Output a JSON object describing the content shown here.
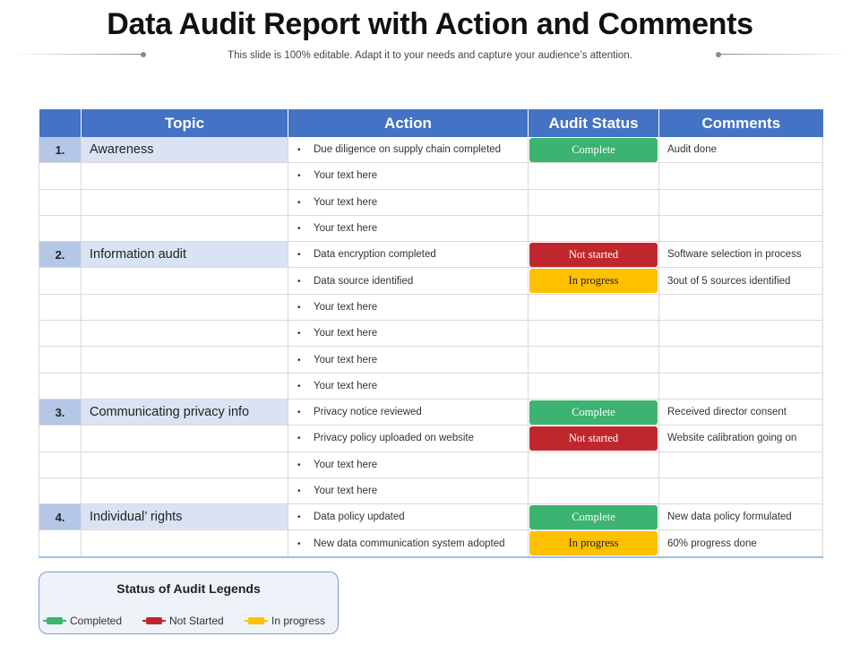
{
  "slide": {
    "title": "Data Audit Report with Action and Comments",
    "subtitle": "This slide is 100% editable. Adapt it to your needs and capture your audience’s attention."
  },
  "table": {
    "headers": {
      "number": "",
      "topic": "Topic",
      "action": "Action",
      "audit_status": "Audit Status",
      "comments": "Comments"
    },
    "rows": [
      {
        "num": "1.",
        "topic": "Awareness",
        "action": "Due diligence on supply chain completed",
        "status": "Complete",
        "status_type": "complete",
        "comment": "Audit done"
      },
      {
        "num": "",
        "topic": "",
        "action": "Your text here",
        "status": "",
        "status_type": "",
        "comment": ""
      },
      {
        "num": "",
        "topic": "",
        "action": "Your text here",
        "status": "",
        "status_type": "",
        "comment": ""
      },
      {
        "num": "",
        "topic": "",
        "action": "Your text here",
        "status": "",
        "status_type": "",
        "comment": ""
      },
      {
        "num": "2.",
        "topic": "Information audit",
        "action": "Data encryption completed",
        "status": "Not started",
        "status_type": "not-started",
        "comment": "Software selection in process"
      },
      {
        "num": "",
        "topic": "",
        "action": "Data source identified",
        "status": "In progress",
        "status_type": "in-progress",
        "comment": "3out of 5 sources identified"
      },
      {
        "num": "",
        "topic": "",
        "action": "Your text here",
        "status": "",
        "status_type": "",
        "comment": ""
      },
      {
        "num": "",
        "topic": "",
        "action": "Your text here",
        "status": "",
        "status_type": "",
        "comment": ""
      },
      {
        "num": "",
        "topic": "",
        "action": "Your text here",
        "status": "",
        "status_type": "",
        "comment": ""
      },
      {
        "num": "",
        "topic": "",
        "action": "Your text here",
        "status": "",
        "status_type": "",
        "comment": ""
      },
      {
        "num": "3.",
        "topic": "Communicating privacy info",
        "action": "Privacy notice reviewed",
        "status": "Complete",
        "status_type": "complete",
        "comment": "Received director consent"
      },
      {
        "num": "",
        "topic": "",
        "action": "Privacy policy uploaded on website",
        "status": "Not started",
        "status_type": "not-started",
        "comment": "Website calibration going on"
      },
      {
        "num": "",
        "topic": "",
        "action": "Your text here",
        "status": "",
        "status_type": "",
        "comment": ""
      },
      {
        "num": "",
        "topic": "",
        "action": "Your text here",
        "status": "",
        "status_type": "",
        "comment": ""
      },
      {
        "num": "4.",
        "topic": "Individual’ rights",
        "action": "Data policy updated",
        "status": "Complete",
        "status_type": "complete",
        "comment": "New data policy formulated"
      },
      {
        "num": "",
        "topic": "",
        "action": "New data communication system adopted",
        "status": "In progress",
        "status_type": "in-progress",
        "comment": "60% progress done"
      }
    ]
  },
  "legend": {
    "title": "Status of Audit  Legends",
    "items": [
      {
        "label": "Completed",
        "color": "#3cb371",
        "icon": "green-marker-icon"
      },
      {
        "label": "Not Started",
        "color": "#c0272d",
        "icon": "red-marker-icon"
      },
      {
        "label": "In progress",
        "color": "#ffc000",
        "icon": "yellow-marker-icon"
      }
    ]
  },
  "colors": {
    "header_blue": "#4472c4",
    "number_cell": "#b4c7e7",
    "topic_cell": "#dae3f3",
    "complete": "#3cb371",
    "not_started": "#c0272d",
    "in_progress": "#ffc000"
  }
}
